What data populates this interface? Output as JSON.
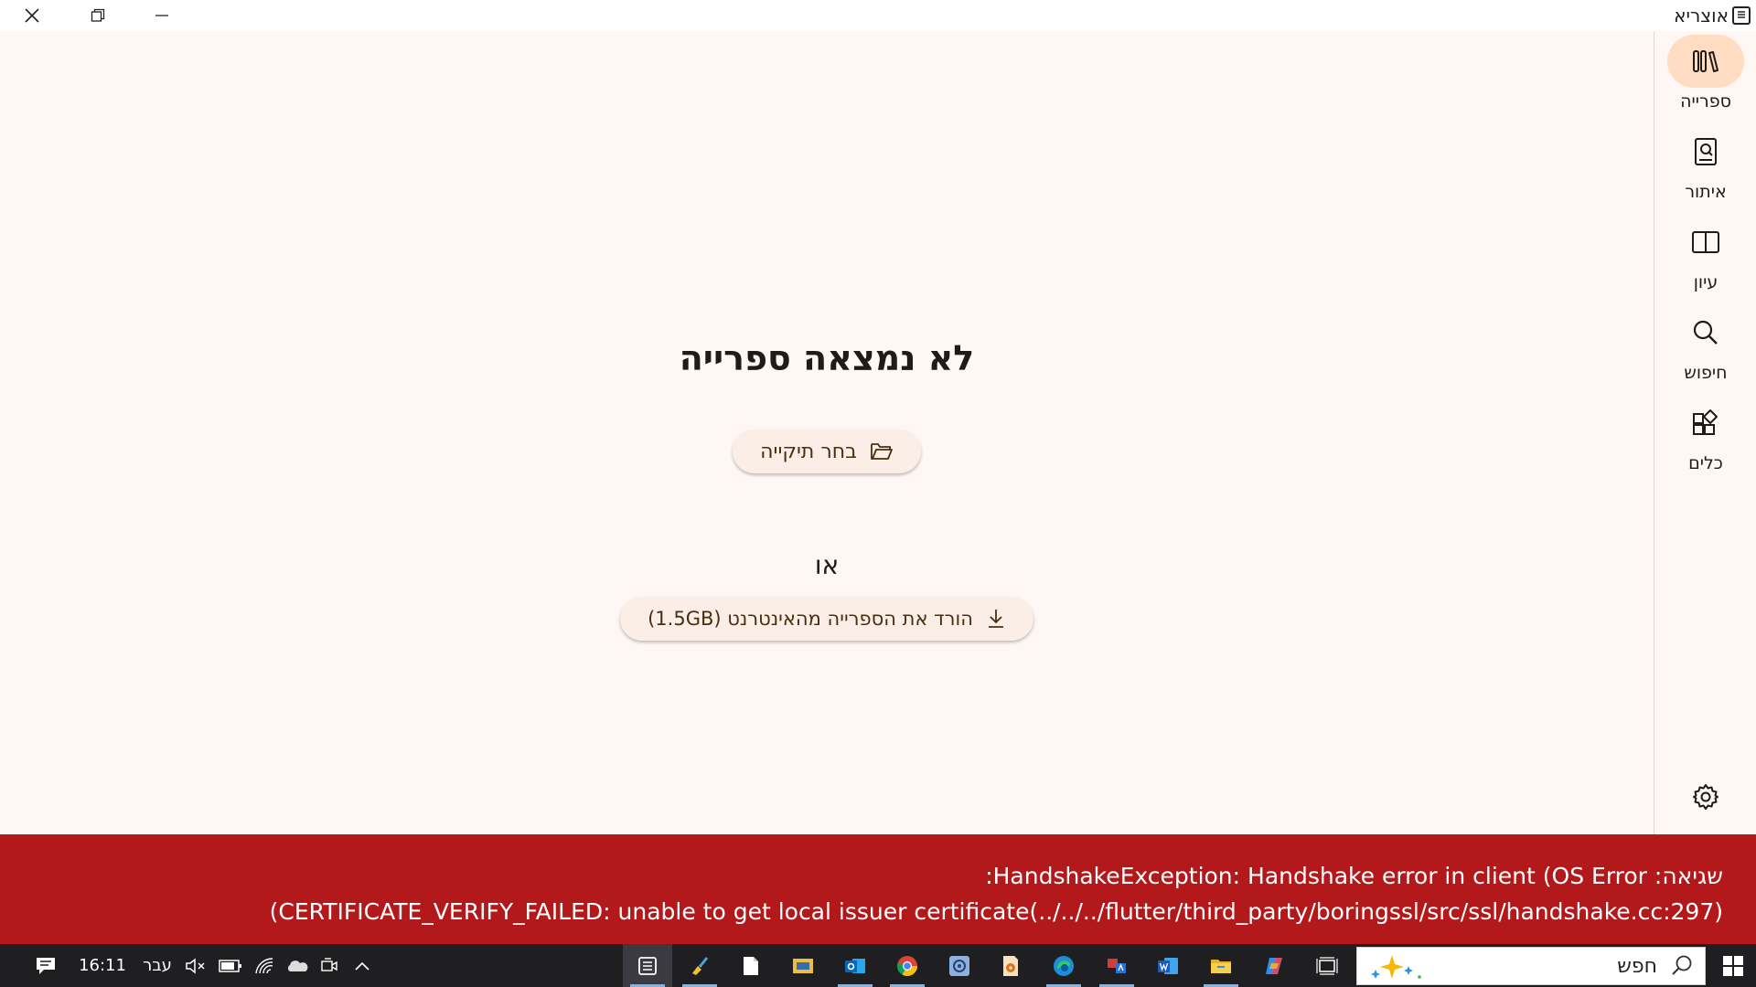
{
  "window": {
    "title": "אוצריא",
    "controls": [
      "close",
      "restore",
      "minimize"
    ]
  },
  "main": {
    "heading": "לא נמצאה ספרייה",
    "choose_folder_label": "בחר תיקייה",
    "or_label": "או",
    "download_label": "הורד את הספרייה מהאינטרנט (1.5GB)"
  },
  "sidebar": {
    "items": [
      {
        "label": "ספרייה",
        "icon": "library-icon",
        "active": true
      },
      {
        "label": "איתור",
        "icon": "find-book-icon",
        "active": false
      },
      {
        "label": "עיון",
        "icon": "book-open-icon",
        "active": false
      },
      {
        "label": "חיפוש",
        "icon": "search-icon",
        "active": false
      },
      {
        "label": "כלים",
        "icon": "tools-icon",
        "active": false
      }
    ],
    "settings_icon": "gear-icon"
  },
  "error": {
    "line1": "שגיאה: HandshakeException: Handshake error in client (OS Error:",
    "line2": "CERTIFICATE_VERIFY_FAILED: unable to get local issuer certificate(../../../flutter/third_party/boringssl/src/ssl/handshake.cc:297))"
  },
  "taskbar": {
    "clock": "16:11",
    "language": "עבר",
    "search_placeholder": "חפש",
    "tray_icons": [
      "notification-icon",
      "volume-muted-icon",
      "battery-icon",
      "wifi-icon",
      "onedrive-icon",
      "meet-now-icon",
      "chevron-up-icon"
    ],
    "apps": [
      "otzaria-app",
      "brush-app",
      "notepad-app",
      "filmstrip-app",
      "outlook-app",
      "chrome-app",
      "settings-app",
      "media-app",
      "edge-app",
      "translator-app",
      "word-app",
      "file-explorer-app",
      "copilot-app",
      "task-view"
    ]
  },
  "colors": {
    "background": "#fff7f4",
    "accent": "#ffdcc2",
    "error": "#b3191b",
    "taskbar": "#1f1f22"
  }
}
